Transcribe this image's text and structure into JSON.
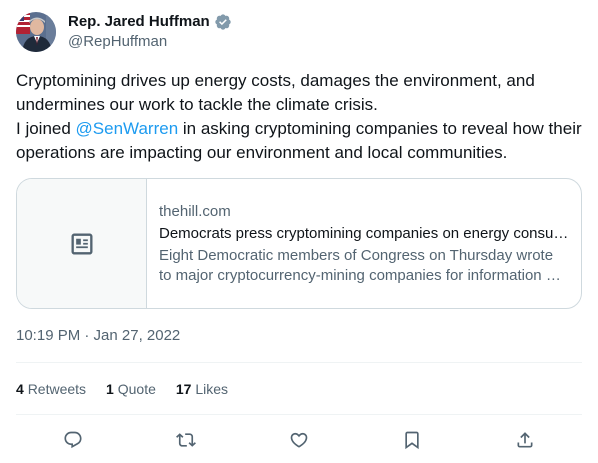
{
  "author": {
    "display_name": "Rep. Jared Huffman",
    "handle": "@RepHuffman",
    "verified_icon": "verified-badge-icon"
  },
  "tweet": {
    "line1": "Cryptomining drives up energy costs, damages the environment, and undermines our work to tackle the climate crisis.",
    "line2_prefix": "I joined ",
    "mention": "@SenWarren",
    "line2_suffix": " in asking cryptomining companies to reveal how their operations are impacting our environment and local communities."
  },
  "card": {
    "domain": "thehill.com",
    "title": "Democrats press cryptomining companies on energy consumption",
    "description": "Eight Democratic members of Congress on Thursday wrote to major cryptocurrency-mining companies for information on their energy consumption",
    "thumb_icon": "news-article-icon"
  },
  "timestamp": "10:19 PM · Jan 27, 2022",
  "stats": {
    "retweets_count": "4",
    "retweets_label": "Retweets",
    "quotes_count": "1",
    "quotes_label": "Quote",
    "likes_count": "17",
    "likes_label": "Likes"
  },
  "actions": [
    "reply-icon",
    "retweet-icon",
    "like-icon",
    "bookmark-icon",
    "share-icon"
  ],
  "colors": {
    "accent": "#1d9bf0",
    "text": "#0f1419",
    "secondary": "#536471",
    "border": "#cfd9de"
  }
}
